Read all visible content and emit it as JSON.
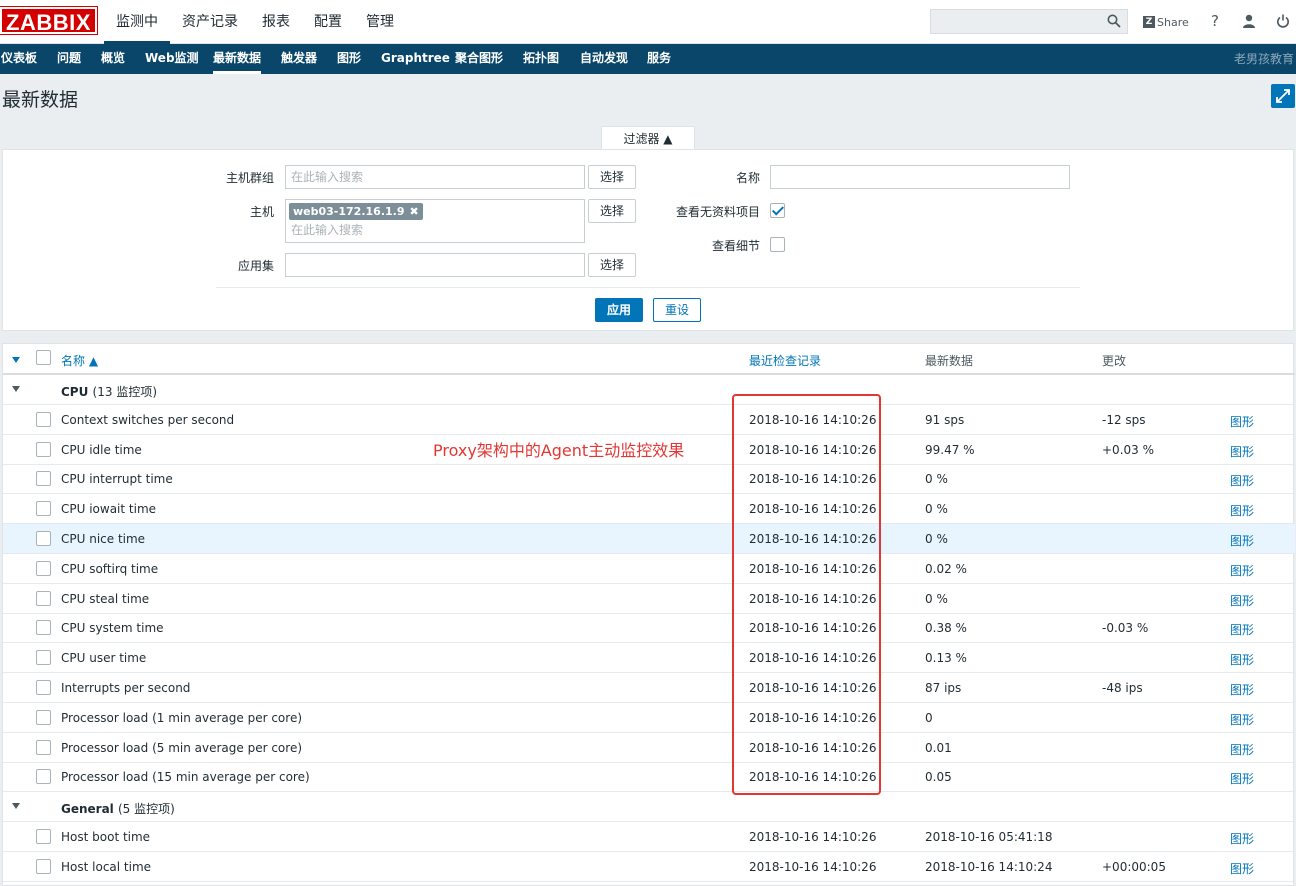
{
  "header": {
    "logo": "ZABBIX",
    "menu": [
      "监测中",
      "资产记录",
      "报表",
      "配置",
      "管理"
    ],
    "search_placeholder": "",
    "share_label": "Share",
    "help_icon": "?"
  },
  "nav": {
    "items": [
      "仪表板",
      "问题",
      "概览",
      "Web监测",
      "最新数据",
      "触发器",
      "图形",
      "Graphtree",
      "聚合图形",
      "拓扑图",
      "自动发现",
      "服务"
    ],
    "active": "最新数据",
    "brand": "老男孩教育"
  },
  "page": {
    "title": "最新数据"
  },
  "filter": {
    "tab_label": "过滤器 ▲",
    "host_group_label": "主机群组",
    "host_group_placeholder": "在此输入搜索",
    "host_label": "主机",
    "host_tag": "web03-172.16.1.9",
    "host_tag_x": "✖",
    "host_placeholder": "在此输入搜索",
    "app_label": "应用集",
    "app_value": "",
    "select_label": "选择",
    "name_label": "名称",
    "name_value": "",
    "show_no_data_label": "查看无资料项目",
    "show_details_label": "查看细节",
    "apply_label": "应用",
    "reset_label": "重设"
  },
  "table": {
    "headers": {
      "name": "名称 ▲",
      "last_check": "最近检查记录",
      "last_value": "最新数据",
      "change": "更改"
    },
    "graph_label": "图形",
    "groups": [
      {
        "name": "CPU",
        "count": "(13 监控项)",
        "rows": [
          {
            "name": "Context switches per second",
            "last_check": "2018-10-16 14:10:26",
            "value": "91 sps",
            "change": "-12 sps"
          },
          {
            "name": "CPU idle time",
            "last_check": "2018-10-16 14:10:26",
            "value": "99.47 %",
            "change": "+0.03 %"
          },
          {
            "name": "CPU interrupt time",
            "last_check": "2018-10-16 14:10:26",
            "value": "0 %",
            "change": ""
          },
          {
            "name": "CPU iowait time",
            "last_check": "2018-10-16 14:10:26",
            "value": "0 %",
            "change": ""
          },
          {
            "name": "CPU nice time",
            "last_check": "2018-10-16 14:10:26",
            "value": "0 %",
            "change": ""
          },
          {
            "name": "CPU softirq time",
            "last_check": "2018-10-16 14:10:26",
            "value": "0.02 %",
            "change": ""
          },
          {
            "name": "CPU steal time",
            "last_check": "2018-10-16 14:10:26",
            "value": "0 %",
            "change": ""
          },
          {
            "name": "CPU system time",
            "last_check": "2018-10-16 14:10:26",
            "value": "0.38 %",
            "change": "-0.03 %"
          },
          {
            "name": "CPU user time",
            "last_check": "2018-10-16 14:10:26",
            "value": "0.13 %",
            "change": ""
          },
          {
            "name": "Interrupts per second",
            "last_check": "2018-10-16 14:10:26",
            "value": "87 ips",
            "change": "-48 ips"
          },
          {
            "name": "Processor load (1 min average per core)",
            "last_check": "2018-10-16 14:10:26",
            "value": "0",
            "change": ""
          },
          {
            "name": "Processor load (5 min average per core)",
            "last_check": "2018-10-16 14:10:26",
            "value": "0.01",
            "change": ""
          },
          {
            "name": "Processor load (15 min average per core)",
            "last_check": "2018-10-16 14:10:26",
            "value": "0.05",
            "change": ""
          }
        ]
      },
      {
        "name": "General",
        "count": "(5 监控项)",
        "rows": [
          {
            "name": "Host boot time",
            "last_check": "2018-10-16 14:10:26",
            "value": "2018-10-16 05:41:18",
            "change": ""
          },
          {
            "name": "Host local time",
            "last_check": "2018-10-16 14:10:26",
            "value": "2018-10-16 14:10:24",
            "change": "+00:00:05"
          }
        ]
      }
    ]
  },
  "annotation": "Proxy架构中的Agent主动监控效果",
  "colors": {
    "brand_red": "#d40000",
    "nav_blue": "#0a466a",
    "link_blue": "#0275b8",
    "annotation_red": "#e33734",
    "highlight_row": "#e8f5ff"
  }
}
